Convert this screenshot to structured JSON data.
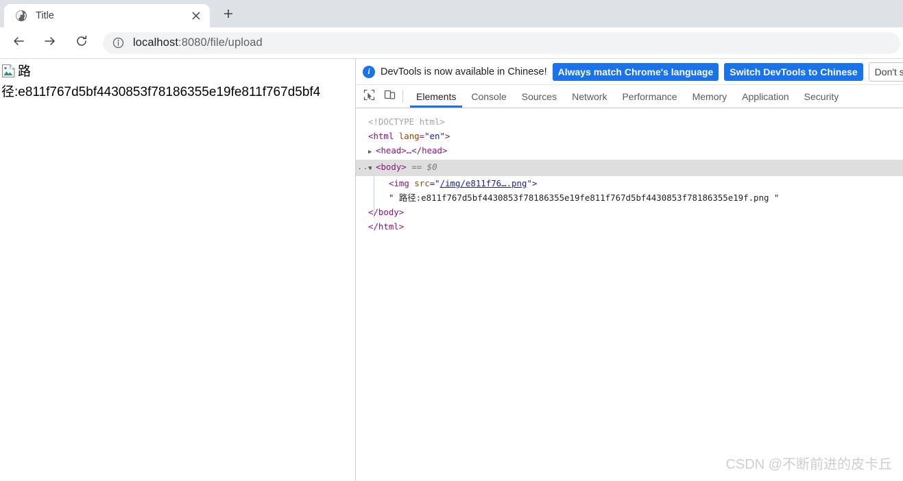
{
  "browser": {
    "tab": {
      "title": "Title",
      "favicon_icon": "globe-icon",
      "close_icon": "close-icon"
    },
    "new_tab_icon": "plus-icon",
    "nav": {
      "back_icon": "arrow-left-icon",
      "forward_icon": "arrow-right-icon",
      "reload_icon": "reload-icon"
    },
    "omnibox": {
      "info_icon": "info-circle-icon",
      "url_host": "localhost",
      "url_path": ":8080/file/upload"
    }
  },
  "page": {
    "broken_image_icon": "broken-image-icon",
    "line1": "路",
    "line2": "径:e811f767d5bf4430853f78186355e19fe811f767d5bf4"
  },
  "devtools": {
    "notice": {
      "info_icon": "info-circle-filled-icon",
      "message": "DevTools is now available in Chinese!",
      "btn_always": "Always match Chrome's language",
      "btn_switch": "Switch DevTools to Chinese",
      "btn_dismiss": "Don't sho"
    },
    "toolbar": {
      "inspect_icon": "inspect-element-icon",
      "device_icon": "device-toolbar-icon"
    },
    "tabs": [
      {
        "label": "Elements",
        "active": true
      },
      {
        "label": "Console",
        "active": false
      },
      {
        "label": "Sources",
        "active": false
      },
      {
        "label": "Network",
        "active": false
      },
      {
        "label": "Performance",
        "active": false
      },
      {
        "label": "Memory",
        "active": false
      },
      {
        "label": "Application",
        "active": false
      },
      {
        "label": "Security",
        "active": false
      }
    ],
    "dom": {
      "doctype": "<!DOCTYPE html>",
      "html_open_tag": "<html",
      "html_attr_name": " lang",
      "html_attr_value": "\"en\"",
      "html_open_close": ">",
      "head_collapsed": "<head>…</head>",
      "body_open": "<body>",
      "body_selected_marker": "== $0",
      "body_badge": "...",
      "img_prefix": "<img ",
      "img_attr_name": "src",
      "img_eq_quote": "=\"",
      "img_src_value": "/img/e811f76….png",
      "img_suffix": "\">",
      "text_node": "\" 路径:e811f767d5bf4430853f78186355e19fe811f767d5bf4430853f78186355e19f.png \"",
      "body_close": "</body>",
      "html_close": "</html>"
    }
  },
  "watermark": "CSDN @不断前进的皮卡丘",
  "colors": {
    "accent_blue": "#1a73e8",
    "tabstrip_bg": "#dee1e6",
    "omnibox_bg": "#f1f3f4",
    "selected_row": "#dedede"
  }
}
